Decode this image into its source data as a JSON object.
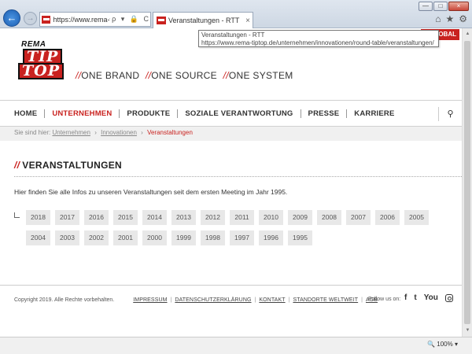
{
  "browser": {
    "address_url": "https://www.rema-ti...",
    "address_icons": "ρ ▾ 🔒 C",
    "tab_title": "Veranstaltungen - RTT",
    "tab_close": "×",
    "tooltip_title": "Veranstaltungen - RTT",
    "tooltip_url": "https://www.rema-tiptop.de/unternehmen/innovationen/round-table/veranstaltungen/",
    "zoom": "100%",
    "back_symbol": "←",
    "forward_symbol": "→",
    "tools": [
      "⌂",
      "★",
      "⚙"
    ],
    "window_buttons": [
      "—",
      "□",
      "×"
    ]
  },
  "header": {
    "global_label": "LOBAL",
    "logo": {
      "line1": "REMA",
      "line2": "TIP",
      "line3": "TOP"
    },
    "slogan": [
      "ONE BRAND",
      "ONE SOURCE",
      "ONE SYSTEM"
    ],
    "slogan_prefix": "//"
  },
  "nav": {
    "items": [
      {
        "label": "HOME",
        "active": false
      },
      {
        "label": "UNTERNEHMEN",
        "active": true
      },
      {
        "label": "PRODUKTE",
        "active": false
      },
      {
        "label": "SOZIALE VERANTWORTUNG",
        "active": false
      },
      {
        "label": "PRESSE",
        "active": false
      },
      {
        "label": "KARRIERE",
        "active": false
      }
    ],
    "search_symbol": "⚲"
  },
  "breadcrumb": {
    "prefix": "Sie sind hier:",
    "links": [
      "Unternehmen",
      "Innovationen"
    ],
    "current": "Veranstaltungen",
    "separator": "›"
  },
  "content": {
    "title": "VERANSTALTUNGEN",
    "title_prefix": "//",
    "intro": "Hier finden Sie alle Infos zu unseren Veranstaltungen seit dem ersten Meeting im Jahr 1995.",
    "years": [
      "2018",
      "2017",
      "2016",
      "2015",
      "2014",
      "2013",
      "2012",
      "2011",
      "2010",
      "2009",
      "2008",
      "2007",
      "2006",
      "2005",
      "2004",
      "2003",
      "2002",
      "2001",
      "2000",
      "1999",
      "1998",
      "1997",
      "1996",
      "1995"
    ]
  },
  "footer": {
    "copyright": "Copyright 2019. Alle Rechte vorbehalten.",
    "links": [
      "IMPRESSUM",
      "DATENSCHUTZERKLÄRUNG",
      "KONTAKT",
      "STANDORTE WELTWEIT",
      "AGB"
    ],
    "follow": "Follow us on:",
    "social": [
      "f",
      "t",
      "You"
    ]
  },
  "colors": {
    "accent": "#c9221f"
  }
}
